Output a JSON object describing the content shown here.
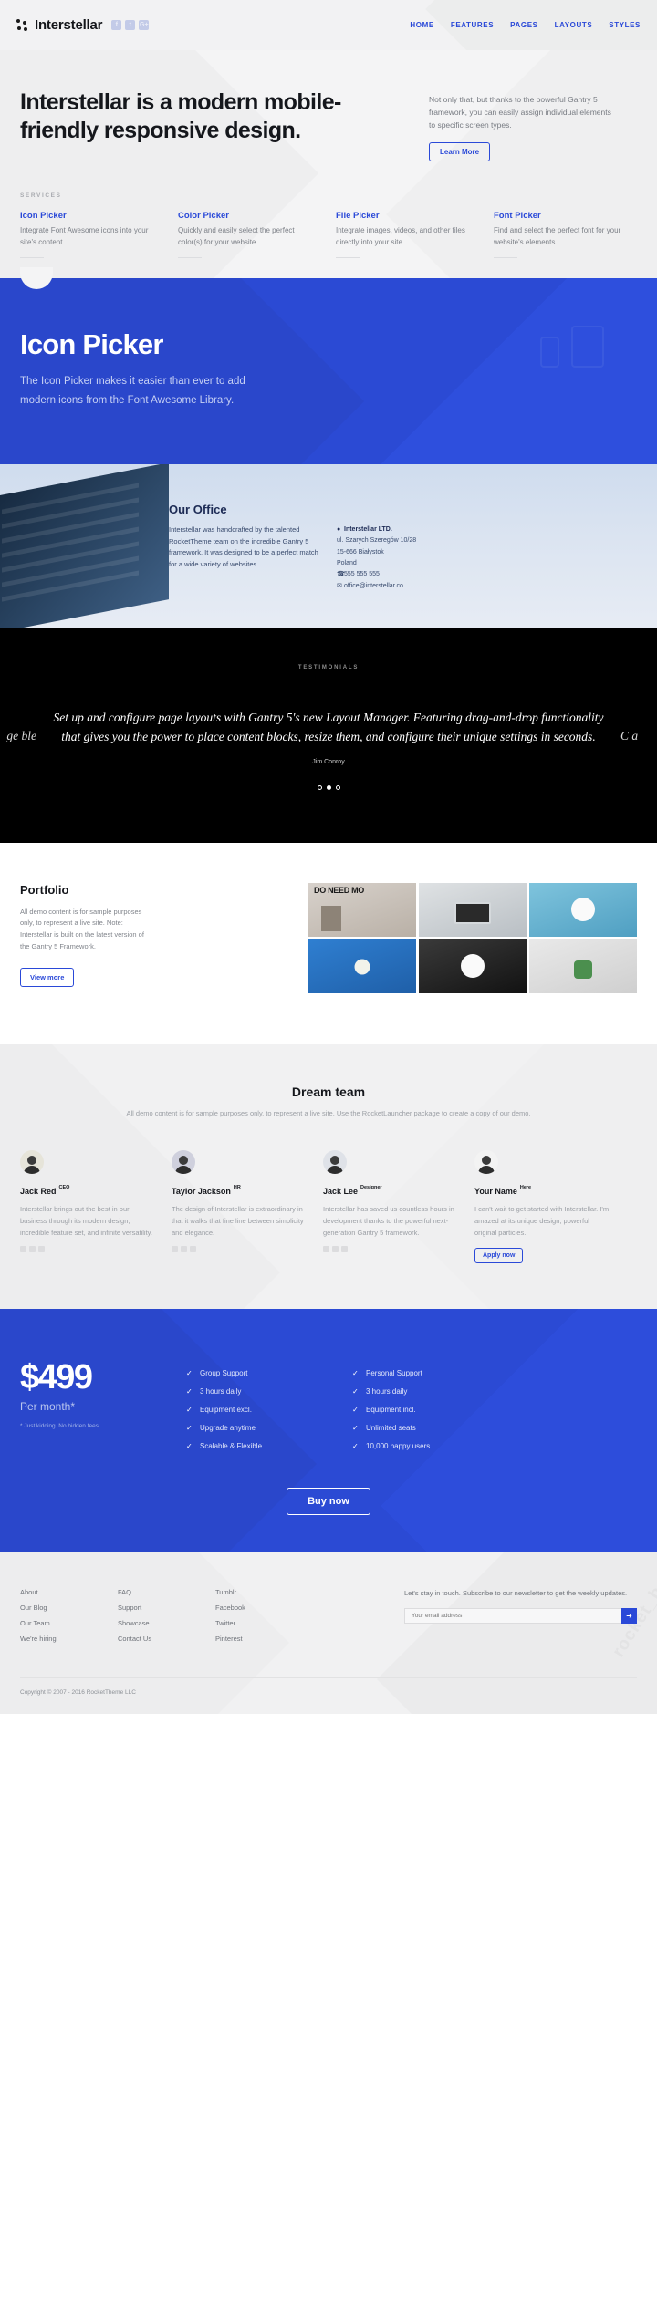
{
  "header": {
    "logo": "Interstellar",
    "social": [
      {
        "name": "facebook-icon",
        "glyph": "f"
      },
      {
        "name": "twitter-icon",
        "glyph": "t"
      },
      {
        "name": "googleplus-icon",
        "glyph": "G+"
      }
    ],
    "nav": [
      "HOME",
      "FEATURES",
      "PAGES",
      "LAYOUTS",
      "STYLES"
    ]
  },
  "intro": {
    "headline": "Interstellar is a modern mobile-friendly responsive design.",
    "paragraph": "Not only that, but thanks to the powerful Gantry 5 framework, you can easily assign individual elements to specific screen types.",
    "button": "Learn More",
    "services_label": "SERVICES",
    "services": [
      {
        "title": "Icon Picker",
        "text": "Integrate Font Awesome icons into your site's content."
      },
      {
        "title": "Color Picker",
        "text": "Quickly and easily select the perfect color(s) for your website."
      },
      {
        "title": "File Picker",
        "text": "Integrate images, videos, and other files directly into your site."
      },
      {
        "title": "Font Picker",
        "text": "Find and select the perfect font for your website's elements."
      }
    ]
  },
  "iconpicker": {
    "title": "Icon Picker",
    "text": "The Icon Picker makes it easier than ever to add modern icons from the Font Awesome Library."
  },
  "office": {
    "title": "Our Office",
    "text": "Interstellar was handcrafted by the talented RocketTheme team on the incredible Gantry 5 framework. It was designed to be a perfect match for a wide variety of websites.",
    "company": "Interstellar LTD.",
    "street": "ul. Szarych Szeregów 10/28",
    "city": "15-666 Białystok",
    "country": "Poland",
    "phone": "555 555 555",
    "email": "office@interstellar.co"
  },
  "testimonials": {
    "label": "TESTIMONIALS",
    "quote": "Set up and configure page layouts with Gantry 5's new Layout Manager. Featuring drag-and-drop functionality that gives you the power to place content blocks, resize them, and configure their unique settings in seconds.",
    "author": "Jim Conroy",
    "ghost_left": "ge ble",
    "ghost_right": "C a",
    "slides": 3,
    "active_slide": 2
  },
  "portfolio": {
    "title": "Portfolio",
    "text": "All demo content is for sample purposes only, to represent a live site. Note: Interstellar is built on the latest version of the Gantry 5 Framework.",
    "button": "View more",
    "tile_caption": "DO NEED MO"
  },
  "team": {
    "title": "Dream team",
    "subtitle": "All demo content is for sample purposes only, to represent a live site. Use the RocketLauncher package to create a copy of our demo.",
    "members": [
      {
        "name": "Jack Red",
        "role": "CEO",
        "text": "Interstellar brings out the best in our business through its modern design, incredible feature set, and infinite versatility.",
        "button": ""
      },
      {
        "name": "Taylor Jackson",
        "role": "HR",
        "text": "The design of Interstellar is extraordinary in that it walks that fine line between simplicity and elegance.",
        "button": ""
      },
      {
        "name": "Jack Lee",
        "role": "Designer",
        "text": "Interstellar has saved us countless hours in development thanks to the powerful next-generation Gantry 5 framework.",
        "button": ""
      },
      {
        "name": "Your Name",
        "role": "Here",
        "text": "I can't wait to get started with Interstellar. I'm amazed at its unique design, powerful original particles.",
        "button": "Apply now"
      }
    ]
  },
  "pricing": {
    "price": "$499",
    "period": "Per month*",
    "note": "* Just kidding. No hidden fees.",
    "features_left": [
      "Group Support",
      "3 hours daily",
      "Equipment excl.",
      "Upgrade anytime",
      "Scalable & Flexible"
    ],
    "features_right": [
      "Personal Support",
      "3 hours daily",
      "Equipment incl.",
      "Unlimited seats",
      "10,000 happy users"
    ],
    "button": "Buy now"
  },
  "footer": {
    "col1": [
      "About",
      "Our Blog",
      "Our Team",
      "We're hiring!"
    ],
    "col2": [
      "FAQ",
      "Support",
      "Showcase",
      "Contact Us"
    ],
    "col3": [
      "Tumblr",
      "Facebook",
      "Twitter",
      "Pinterest"
    ],
    "newsletter_text": "Let's stay in touch. Subscribe to our newsletter to get the weekly updates.",
    "newsletter_placeholder": "Your email address",
    "submit_glyph": "➜",
    "watermark": "rocket_box",
    "copyright": "Copyright © 2007 - 2016 RocketTheme LLC"
  },
  "colors": {
    "accent": "#2a49d8",
    "hero_blue": "#2b4ad4",
    "dark": "#000000"
  }
}
